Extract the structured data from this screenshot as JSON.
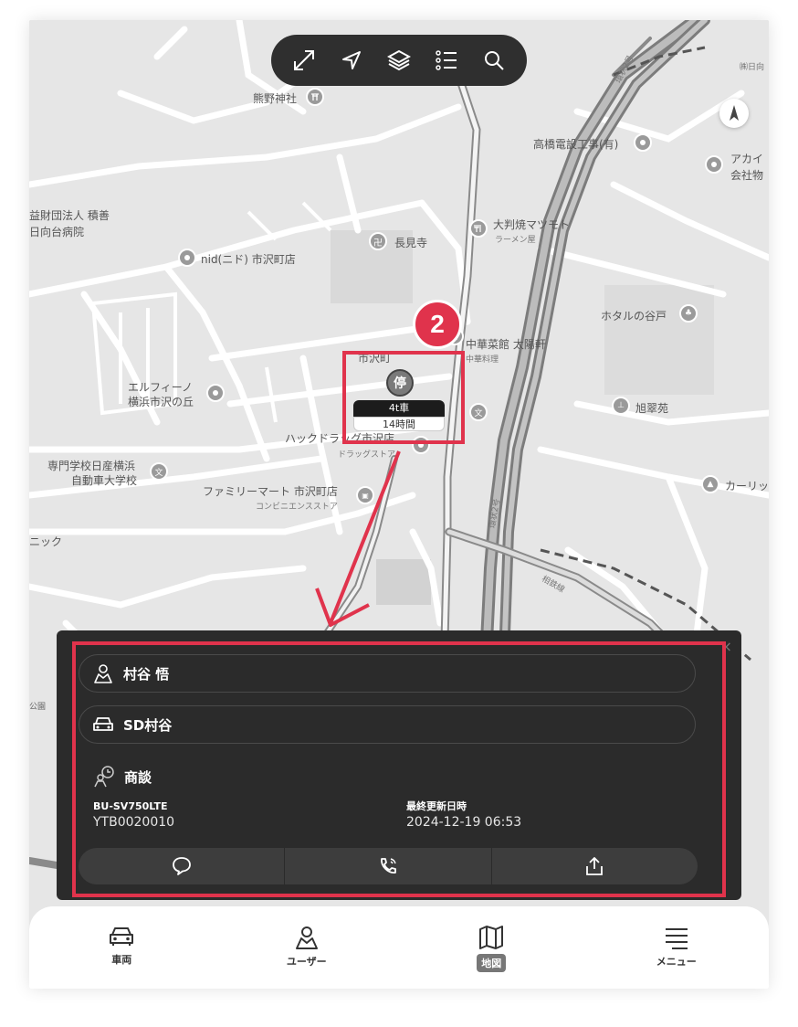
{
  "colors": {
    "accent": "#e0334c",
    "panel": "#2b2b2b",
    "map": "#e6e6e6"
  },
  "toolbar": {
    "buttons": [
      {
        "icon": "expand-icon"
      },
      {
        "icon": "location-arrow-icon"
      },
      {
        "icon": "layers-icon"
      },
      {
        "icon": "list-icon"
      },
      {
        "icon": "search-icon"
      }
    ]
  },
  "map": {
    "labels": {
      "kumano": "熊野神社",
      "koeki": "益財団法人 積善",
      "hinata": "日向台病院",
      "nid": "nid(ニド) 市沢町店",
      "chokenji": "長見寺",
      "ohanjo": "大判焼マツモト",
      "ramen": "ラーメン屋",
      "takahashi": "高橋電設工事(有)",
      "akai": "アカイ",
      "kaisha": "会社物",
      "kabu": "㈱日向",
      "kanjo2a": "環状2号",
      "kanjo2b": "環状2号",
      "hotaru": "ホタルの谷戸",
      "chuka": "中華菜館 太陽軒",
      "chuka_sub": "中華料理",
      "ichisawacho": "市沢町",
      "elfino1": "エルフィーノ",
      "elfino2": "横浜市沢の丘",
      "hack": "ハックドラッグ市沢店",
      "drug": "ドラッグストア",
      "suisui": "旭翠苑",
      "senmon1": "専門学校日産横浜",
      "senmon2": "自動車大学校",
      "family": "ファミリーマート 市沢町店",
      "conv": "コンビニエンスストア",
      "karri": "カーリッ",
      "nick": "ニック",
      "sagami": "相鉄線",
      "park": "公園"
    }
  },
  "vehicle_marker": {
    "status_glyph": "停",
    "name": "4t車",
    "duration": "14時間"
  },
  "step_badge": "2",
  "panel": {
    "user": {
      "name": "村谷 悟"
    },
    "vehicle": {
      "name": "SD村谷"
    },
    "status": {
      "label": "商談"
    },
    "model": {
      "label": "BU-SV750LTE",
      "value": "YTB0020010"
    },
    "updated": {
      "label": "最終更新日時",
      "value": "2024-12-19 06:53"
    },
    "close": "×"
  },
  "nav": {
    "items": [
      {
        "label": "車両",
        "icon": "car-icon",
        "active": false
      },
      {
        "label": "ユーザー",
        "icon": "user-icon",
        "active": false
      },
      {
        "label": "地図",
        "icon": "map-icon",
        "active": true
      },
      {
        "label": "メニュー",
        "icon": "menu-icon",
        "active": false
      }
    ]
  }
}
